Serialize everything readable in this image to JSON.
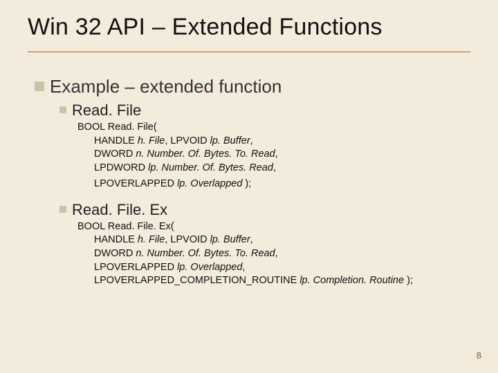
{
  "title": "Win 32 API – Extended Functions",
  "lvl1": "Example – extended function",
  "sections": [
    {
      "heading": "Read. File",
      "lines": [
        {
          "pre": "BOOL Read. File(",
          "indent": false
        },
        {
          "pre": "HANDLE ",
          "ital": "h. File",
          "mid": ", LPVOID ",
          "ital2": "lp. Buffer",
          "post": ",",
          "indent": true
        },
        {
          "pre": "DWORD ",
          "ital": "n. Number. Of. Bytes. To. Read",
          "post": ",",
          "indent": true
        },
        {
          "pre": "LPDWORD ",
          "ital": "lp. Number. Of. Bytes. Read",
          "post": ",",
          "indent": true
        },
        {
          "pre": "LPOVERLAPPED ",
          "ital": "lp. Overlapped",
          "post": " );",
          "indent": true,
          "gapBefore": true
        }
      ]
    },
    {
      "heading": "Read. File. Ex",
      "lines": [
        {
          "pre": "BOOL Read. File. Ex(",
          "indent": false
        },
        {
          "pre": "HANDLE ",
          "ital": "h. File",
          "mid": ", LPVOID ",
          "ital2": "lp. Buffer",
          "post": ",",
          "indent": true
        },
        {
          "pre": "DWORD ",
          "ital": "n. Number. Of. Bytes. To. Read",
          "post": ",",
          "indent": true
        },
        {
          "pre": "LPOVERLAPPED ",
          "ital": "lp. Overlapped",
          "post": ",",
          "indent": true
        },
        {
          "pre": "LPOVERLAPPED_COMPLETION_ROUTINE ",
          "ital": "lp. Completion. Routine",
          "post": " );",
          "indent": true
        }
      ]
    }
  ],
  "pageNumber": "8"
}
